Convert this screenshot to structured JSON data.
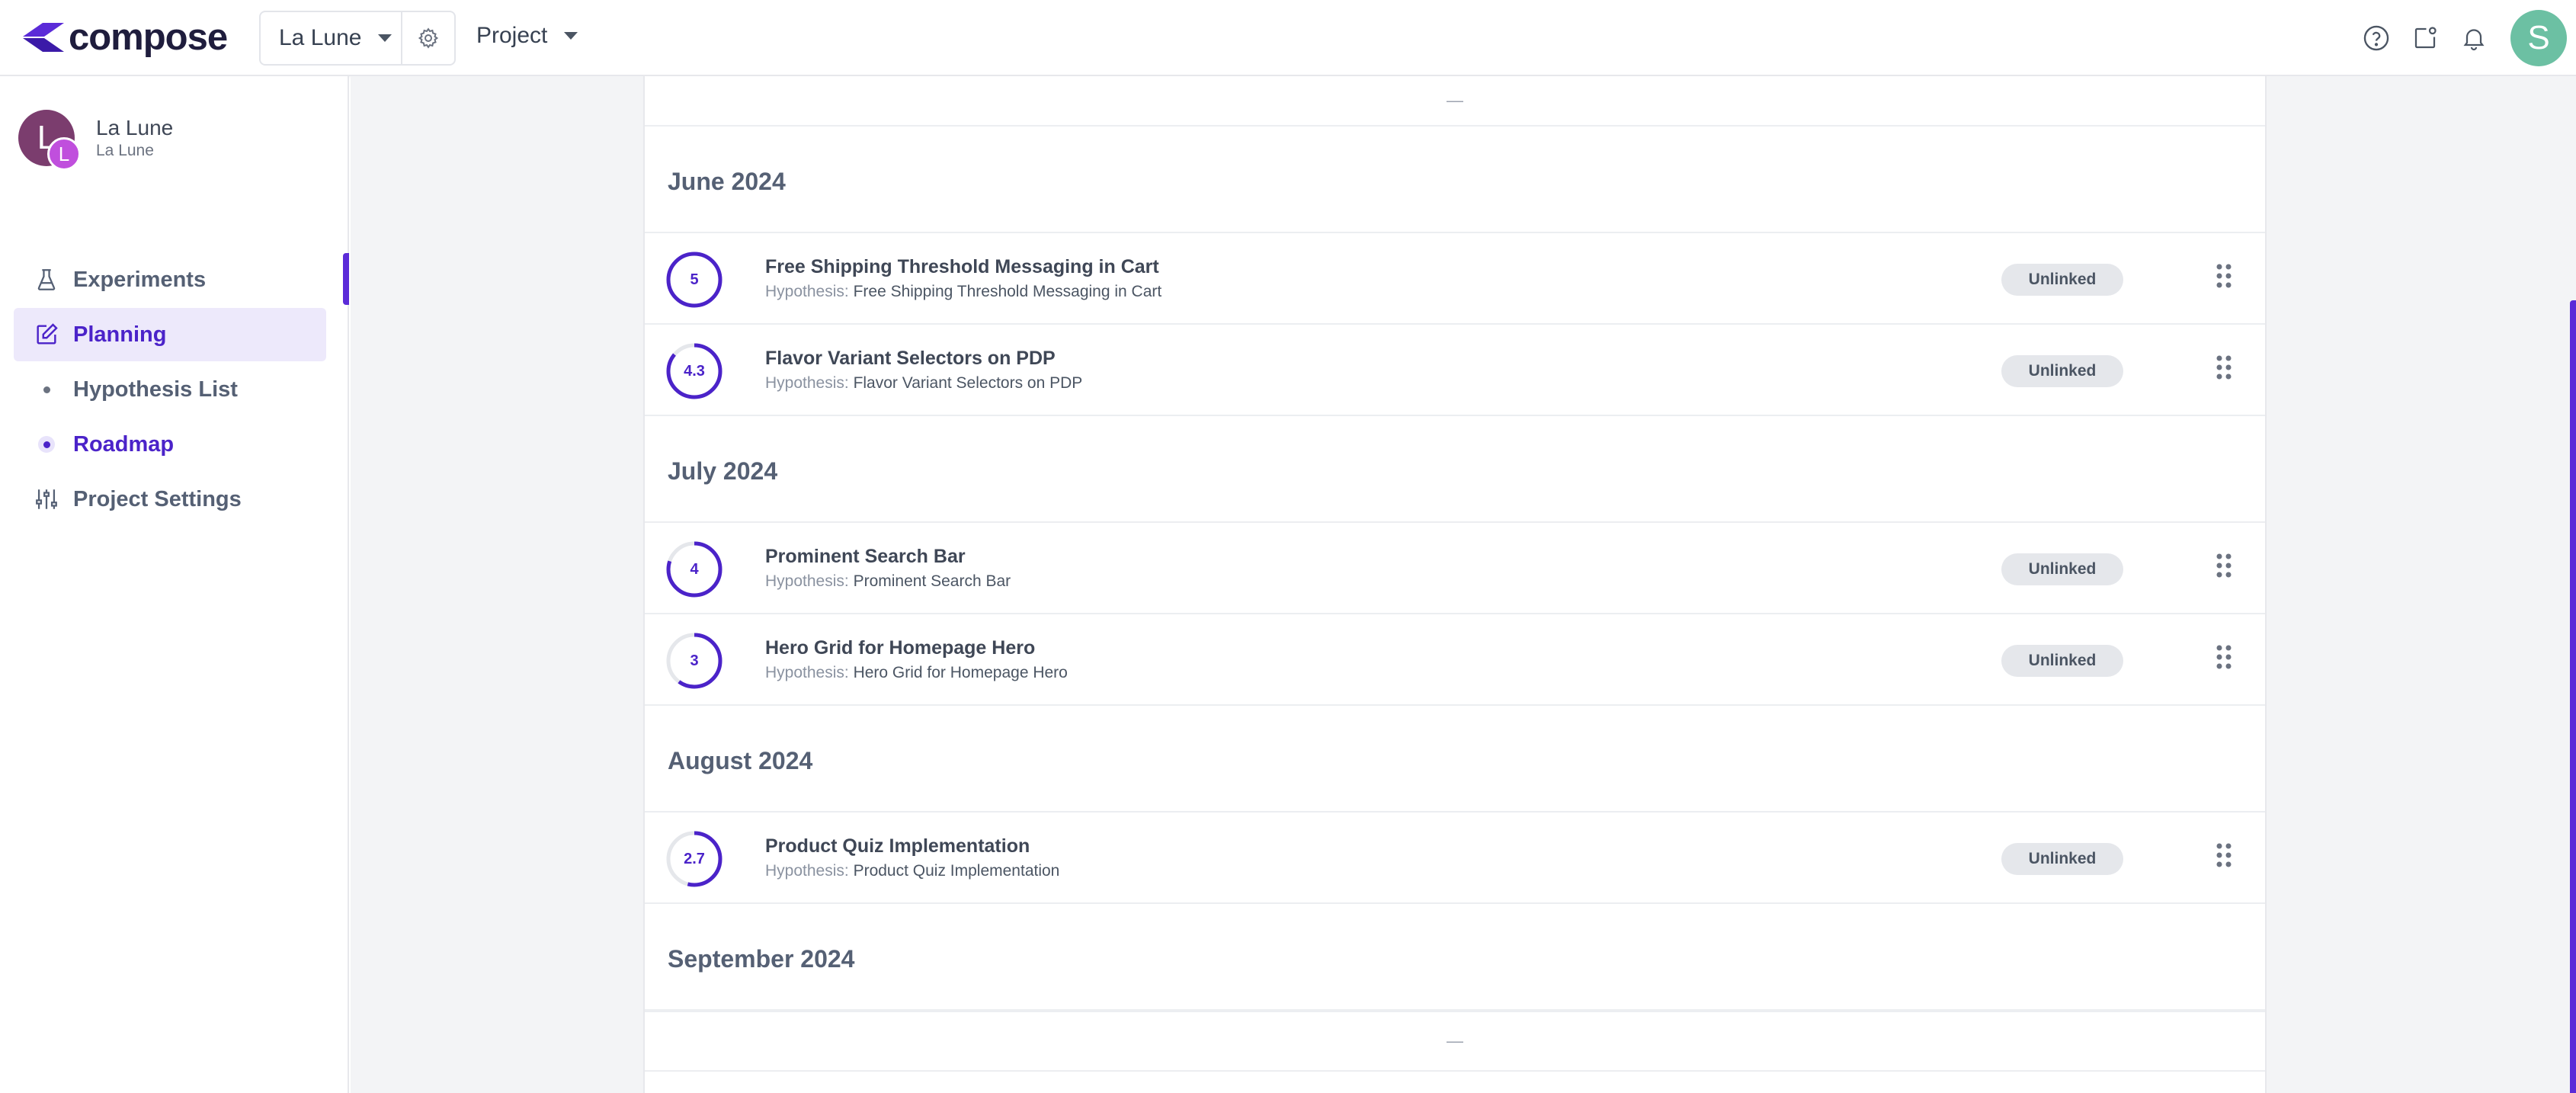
{
  "header": {
    "logo_text": "compose",
    "org_selector": "La Lune",
    "project_selector": "Project",
    "avatar_initial": "S",
    "icons": [
      "help-icon",
      "share-icon",
      "bell-icon"
    ]
  },
  "sidebar": {
    "user": {
      "initial": "L",
      "sub_initial": "L",
      "name": "La Lune",
      "subtitle": "La Lune"
    },
    "items": [
      {
        "label": "Experiments",
        "icon": "flask-icon"
      },
      {
        "label": "Planning",
        "icon": "edit-icon"
      },
      {
        "label": "Hypothesis List",
        "icon": "dot"
      },
      {
        "label": "Roadmap",
        "icon": "dot"
      },
      {
        "label": "Project Settings",
        "icon": "sliders-icon"
      }
    ]
  },
  "roadmap": {
    "empty_marker": "—",
    "hypothesis_prefix": "Hypothesis:",
    "months": [
      {
        "label": "June 2024",
        "items": [
          {
            "score": "5",
            "score_value": 5,
            "title": "Free Shipping Threshold Messaging in Cart",
            "hypothesis": "Free Shipping Threshold Messaging in Cart",
            "status": "Unlinked"
          },
          {
            "score": "4.3",
            "score_value": 4.3,
            "title": "Flavor Variant Selectors on PDP",
            "hypothesis": "Flavor Variant Selectors on PDP",
            "status": "Unlinked"
          }
        ]
      },
      {
        "label": "July 2024",
        "items": [
          {
            "score": "4",
            "score_value": 4,
            "title": "Prominent Search Bar",
            "hypothesis": "Prominent Search Bar",
            "status": "Unlinked"
          },
          {
            "score": "3",
            "score_value": 3,
            "title": "Hero Grid for Homepage Hero",
            "hypothesis": "Hero Grid for Homepage Hero",
            "status": "Unlinked"
          }
        ]
      },
      {
        "label": "August 2024",
        "items": [
          {
            "score": "2.7",
            "score_value": 2.7,
            "title": "Product Quiz Implementation",
            "hypothesis": "Product Quiz Implementation",
            "status": "Unlinked"
          }
        ]
      },
      {
        "label": "September 2024",
        "items": []
      }
    ]
  },
  "colors": {
    "accent": "#4b23c9",
    "score_track": "#e5e7eb",
    "badge_bg": "#e5e7eb",
    "avatar_user": "#6cc0a3",
    "avatar_org": "#7b3d6e",
    "avatar_org_sub": "#c04fdd"
  }
}
